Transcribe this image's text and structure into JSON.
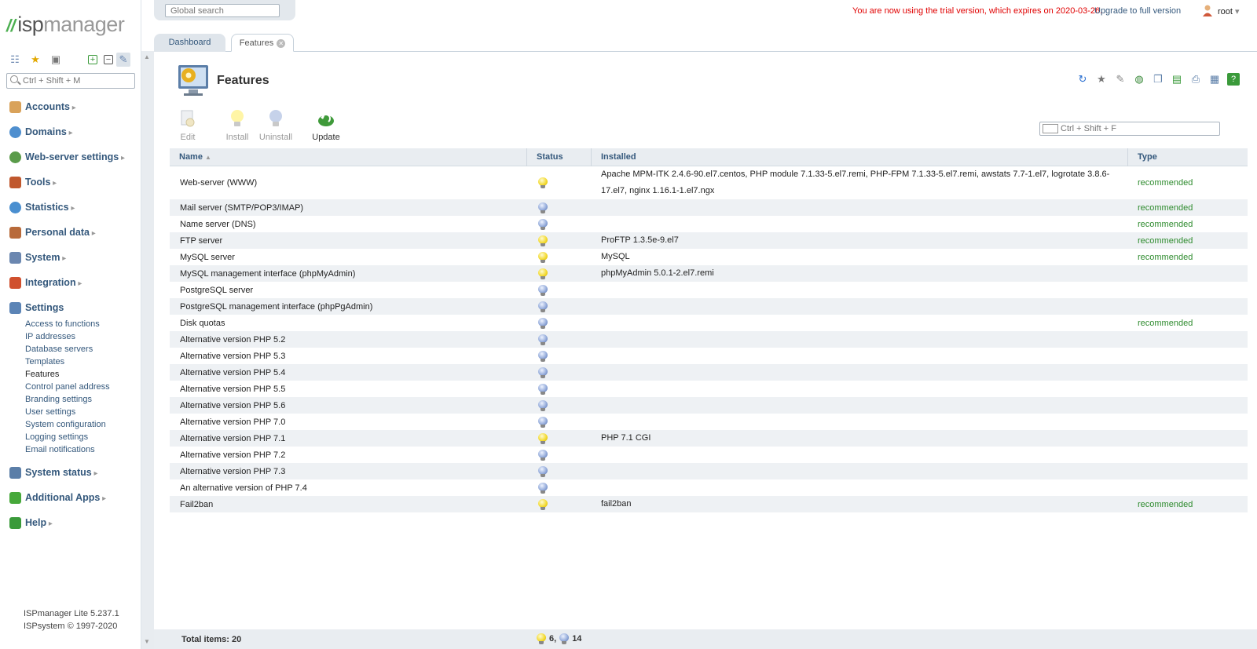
{
  "app": {
    "logo_isp": "isp",
    "logo_manager": "manager"
  },
  "global_search": {
    "placeholder": "Global search"
  },
  "trial": {
    "message": "You are now using the trial version, which expires on 2020-03-26.",
    "upgrade_link": "Upgrade to full version"
  },
  "user": {
    "name": "root"
  },
  "sidebar": {
    "search_placeholder": "Ctrl + Shift + M",
    "menu": [
      {
        "label": "Accounts",
        "icon": "accounts-icon",
        "color": "#d9a25a"
      },
      {
        "label": "Domains",
        "icon": "globe-icon",
        "color": "#4f8fcf"
      },
      {
        "label": "Web-server settings",
        "icon": "web-settings-icon",
        "color": "#5a9b4a"
      },
      {
        "label": "Tools",
        "icon": "tools-icon",
        "color": "#c0582e"
      },
      {
        "label": "Statistics",
        "icon": "statistics-icon",
        "color": "#4a8fd0"
      },
      {
        "label": "Personal data",
        "icon": "books-icon",
        "color": "#b86a3a"
      },
      {
        "label": "System",
        "icon": "system-icon",
        "color": "#6b87b0"
      },
      {
        "label": "Integration",
        "icon": "integration-icon",
        "color": "#d0502e"
      },
      {
        "label": "Settings",
        "icon": "settings-icon",
        "color": "#5b84b6"
      },
      {
        "label": "System status",
        "icon": "monitor-icon",
        "color": "#5b7ea8"
      },
      {
        "label": "Additional Apps",
        "icon": "plus-icon",
        "color": "#46a83a"
      },
      {
        "label": "Help",
        "icon": "help-icon",
        "color": "#3a9a3a"
      }
    ],
    "settings_submenu": [
      "Access to functions",
      "IP addresses",
      "Database servers",
      "Templates",
      "Features",
      "Control panel address",
      "Branding settings",
      "User settings",
      "System configuration",
      "Logging settings",
      "Email notifications"
    ],
    "footer": {
      "version": "ISPmanager Lite 5.237.1",
      "copyright": "ISPsystem © 1997-2020"
    }
  },
  "tabs": [
    {
      "label": "Dashboard"
    },
    {
      "label": "Features"
    }
  ],
  "page": {
    "title": "Features"
  },
  "toolbar": {
    "edit": "Edit",
    "install": "Install",
    "uninstall": "Uninstall",
    "update": "Update",
    "filter_placeholder": "Ctrl + Shift + F"
  },
  "table": {
    "columns": {
      "name": "Name",
      "status": "Status",
      "installed": "Installed",
      "type": "Type"
    },
    "rows": [
      {
        "name": "Web-server (WWW)",
        "on": true,
        "installed": "Apache MPM-ITK 2.4.6-90.el7.centos, PHP module 7.1.33-5.el7.remi, PHP-FPM 7.1.33-5.el7.remi, awstats 7.7-1.el7, logrotate 3.8.6-17.el7, nginx 1.16.1-1.el7.ngx",
        "type": "recommended"
      },
      {
        "name": "Mail server (SMTP/POP3/IMAP)",
        "on": false,
        "installed": "",
        "type": "recommended"
      },
      {
        "name": "Name server (DNS)",
        "on": false,
        "installed": "",
        "type": "recommended"
      },
      {
        "name": "FTP server",
        "on": true,
        "installed": "ProFTP 1.3.5e-9.el7",
        "type": "recommended"
      },
      {
        "name": "MySQL server",
        "on": true,
        "installed": "MySQL",
        "type": "recommended"
      },
      {
        "name": "MySQL management interface (phpMyAdmin)",
        "on": true,
        "installed": "phpMyAdmin 5.0.1-2.el7.remi",
        "type": ""
      },
      {
        "name": "PostgreSQL server",
        "on": false,
        "installed": "",
        "type": ""
      },
      {
        "name": "PostgreSQL management interface (phpPgAdmin)",
        "on": false,
        "installed": "",
        "type": ""
      },
      {
        "name": "Disk quotas",
        "on": false,
        "installed": "",
        "type": "recommended"
      },
      {
        "name": "Alternative version PHP 5.2",
        "on": false,
        "installed": "",
        "type": ""
      },
      {
        "name": "Alternative version PHP 5.3",
        "on": false,
        "installed": "",
        "type": ""
      },
      {
        "name": "Alternative version PHP 5.4",
        "on": false,
        "installed": "",
        "type": ""
      },
      {
        "name": "Alternative version PHP 5.5",
        "on": false,
        "installed": "",
        "type": ""
      },
      {
        "name": "Alternative version PHP 5.6",
        "on": false,
        "installed": "",
        "type": ""
      },
      {
        "name": "Alternative version PHP 7.0",
        "on": false,
        "installed": "",
        "type": ""
      },
      {
        "name": "Alternative version PHP 7.1",
        "on": true,
        "installed": "PHP 7.1 CGI",
        "type": ""
      },
      {
        "name": "Alternative version PHP 7.2",
        "on": false,
        "installed": "",
        "type": ""
      },
      {
        "name": "Alternative version PHP 7.3",
        "on": false,
        "installed": "",
        "type": ""
      },
      {
        "name": "An alternative version of PHP 7.4",
        "on": false,
        "installed": "",
        "type": ""
      },
      {
        "name": "Fail2ban",
        "on": true,
        "installed": "fail2ban",
        "type": "recommended"
      }
    ]
  },
  "footer": {
    "total": "Total items: 20",
    "on_count": "6,",
    "off_count": "14"
  },
  "colors": {
    "link": "#34587c",
    "trial": "#e00000",
    "recommended": "#2e8b2e"
  }
}
